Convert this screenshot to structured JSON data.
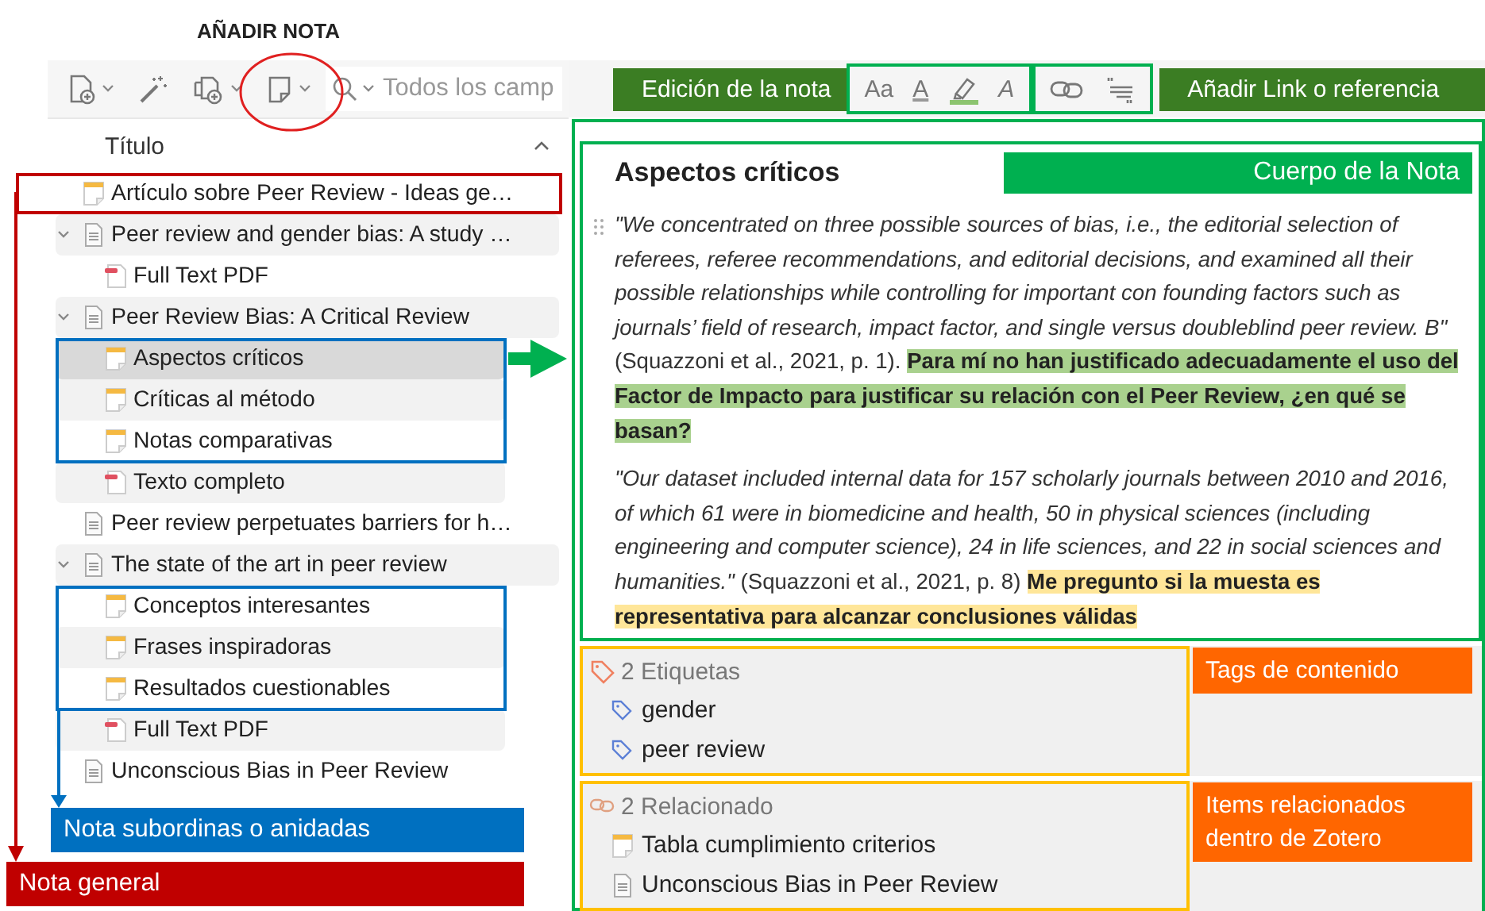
{
  "annotations": {
    "add_note": "AÑADIR NOTA",
    "child_notes": "Nota subordinas o anidadas",
    "general_note": "Nota general",
    "editing": "Edición de la nota",
    "link": "Añadir Link o referencia",
    "body": "Cuerpo de la Nota",
    "tags": "Tags de contenido",
    "related": "Items  relacionados dentro de Zotero"
  },
  "toolbar": {
    "buttons": [
      {
        "kind": "new-item",
        "dropdown": true
      },
      {
        "kind": "wand",
        "dropdown": false
      },
      {
        "kind": "attach",
        "dropdown": true
      },
      {
        "kind": "note",
        "dropdown": true
      }
    ],
    "search": {
      "placeholder": "Todos los camp"
    }
  },
  "column": {
    "title": "Título",
    "sorted_ascending": true
  },
  "items": [
    {
      "kind": "note",
      "title": "Artículo sobre Peer Review - Ideas ge…",
      "selected": false
    },
    {
      "kind": "item",
      "title": "Peer review and gender bias: A study …",
      "selected": false,
      "expanded": true,
      "children": [
        {
          "kind": "pdf",
          "title": "Full Text PDF",
          "selected": false
        }
      ]
    },
    {
      "kind": "item",
      "title": "Peer Review Bias: A Critical Review",
      "selected": false,
      "expanded": true,
      "children": [
        {
          "kind": "note",
          "title": "Aspectos críticos",
          "selected": true
        },
        {
          "kind": "note",
          "title": "Críticas al método",
          "selected": false
        },
        {
          "kind": "note",
          "title": "Notas comparativas",
          "selected": false
        },
        {
          "kind": "pdf",
          "title": "Texto completo",
          "selected": false
        }
      ]
    },
    {
      "kind": "item",
      "title": "Peer review perpetuates barriers for h…",
      "selected": false
    },
    {
      "kind": "item",
      "title": "The state of the art in peer review",
      "selected": false,
      "expanded": true,
      "children": [
        {
          "kind": "note",
          "title": "Conceptos interesantes",
          "selected": false
        },
        {
          "kind": "note",
          "title": "Frases inspiradoras",
          "selected": false
        },
        {
          "kind": "note",
          "title": "Resultados cuestionables",
          "selected": false
        },
        {
          "kind": "pdf",
          "title": "Full Text PDF",
          "selected": false
        }
      ]
    },
    {
      "kind": "item",
      "title": "Unconscious Bias in Peer Review",
      "selected": false
    }
  ],
  "note_toolbar": {
    "groups": [
      [
        {
          "kind": "format",
          "label": "Aa"
        },
        {
          "kind": "text-color",
          "label": "A"
        },
        {
          "kind": "highlight"
        },
        {
          "kind": "clear",
          "label": "A"
        }
      ],
      [
        {
          "kind": "link"
        },
        {
          "kind": "citation"
        }
      ]
    ]
  },
  "note": {
    "title": "Aspectos críticos",
    "paragraphs": [
      {
        "quote": "\"We concentrated on three possible sources of bias, i.e., the editorial selection of referees, referee recommendations, and editorial decisions, and examined all their possible relationships while controlling for important con founding factors such as journals’ field of research, impact factor, and single versus doubleblind peer review. B\"",
        "citation": "(Squazzoni et al., 2021, p. 1).",
        "comment": "Para mí no han justificado adecuadamente el uso del Factor de Impacto para justificar su relación con el Peer Review, ¿en qué se basan?",
        "color": "#a9d18e"
      },
      {
        "quote": "\"Our dataset included internal data for 157 scholarly journals between 2010 and 2016, of which 61 were in biomedicine and health, 50 in physical sciences (including engineering and computer science), 24 in life sciences, and 22 in social sciences and humanities.\"",
        "citation": "(Squazzoni et al., 2021, p. 8)",
        "comment": "Me pregunto si la muesta es representativa para alcanzar conclusiones válidas",
        "color": "#ffe699"
      }
    ]
  },
  "tags": {
    "header": "2 Etiquetas",
    "items": [
      "gender",
      "peer review"
    ]
  },
  "related": {
    "header": "2 Relacionado",
    "items": [
      {
        "kind": "note",
        "title": "Tabla cumplimiento criterios"
      },
      {
        "kind": "item",
        "title": "Unconscious Bias in Peer Review"
      }
    ]
  }
}
